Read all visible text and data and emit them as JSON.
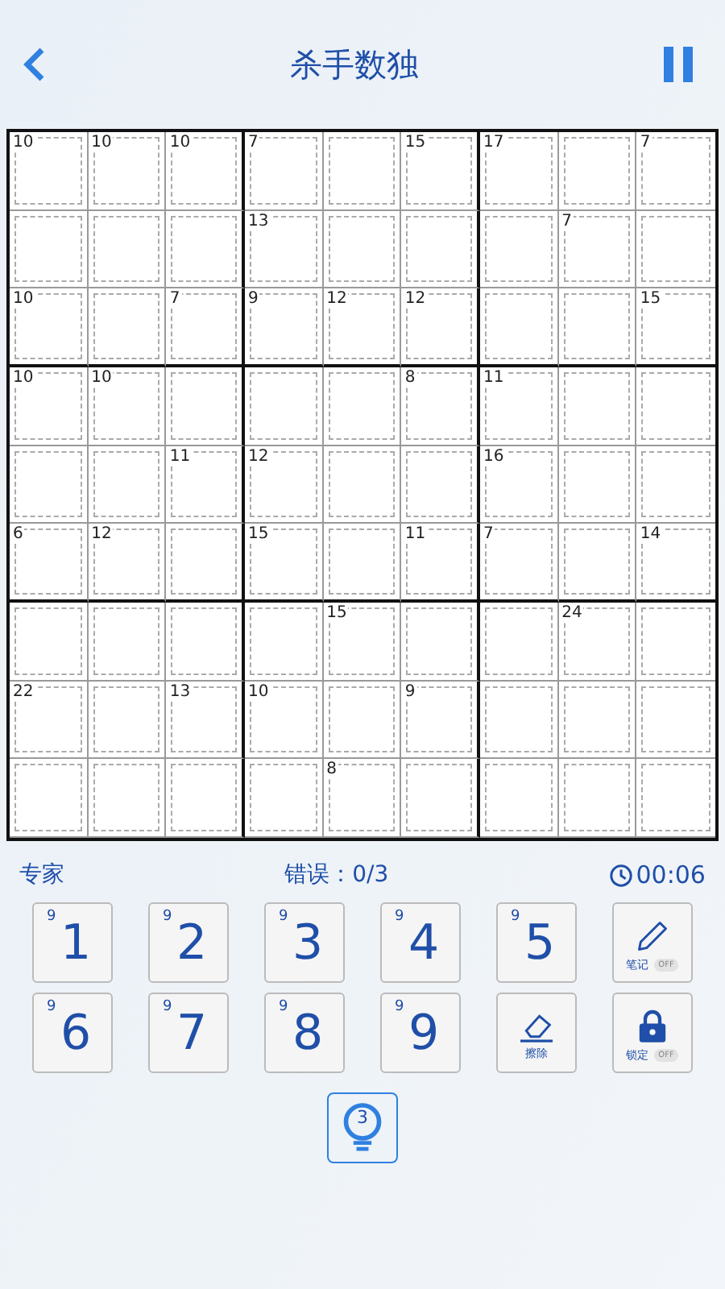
{
  "header": {
    "title": "杀手数独"
  },
  "grid": {
    "rows": [
      [
        {
          "sum": "10"
        },
        {
          "sum": "10"
        },
        {
          "sum": "10"
        },
        {
          "sum": "7"
        },
        {},
        {
          "sum": "15"
        },
        {
          "sum": "17"
        },
        {},
        {
          "sum": "7"
        }
      ],
      [
        {},
        {},
        {},
        {
          "sum": "13"
        },
        {},
        {},
        {},
        {
          "sum": "7"
        },
        {}
      ],
      [
        {
          "sum": "10"
        },
        {},
        {
          "sum": "7"
        },
        {
          "sum": "9"
        },
        {
          "sum": "12"
        },
        {
          "sum": "12"
        },
        {},
        {},
        {
          "sum": "15"
        }
      ],
      [
        {
          "sum": "10"
        },
        {
          "sum": "10"
        },
        {},
        {},
        {},
        {
          "sum": "8"
        },
        {
          "sum": "11"
        },
        {},
        {}
      ],
      [
        {},
        {},
        {
          "sum": "11"
        },
        {
          "sum": "12"
        },
        {},
        {},
        {
          "sum": "16"
        },
        {},
        {}
      ],
      [
        {
          "sum": "6"
        },
        {
          "sum": "12"
        },
        {},
        {
          "sum": "15"
        },
        {},
        {
          "sum": "11"
        },
        {
          "sum": "7"
        },
        {},
        {
          "sum": "14"
        }
      ],
      [
        {},
        {},
        {},
        {},
        {
          "sum": "15"
        },
        {},
        {},
        {
          "sum": "24"
        },
        {}
      ],
      [
        {
          "sum": "22"
        },
        {},
        {
          "sum": "13"
        },
        {
          "sum": "10"
        },
        {},
        {
          "sum": "9"
        },
        {},
        {},
        {}
      ],
      [
        {},
        {},
        {},
        {},
        {
          "sum": "8"
        },
        {},
        {},
        {},
        {}
      ]
    ]
  },
  "info": {
    "difficulty": "专家",
    "mistakes": "错误：0/3",
    "timer": "00:06"
  },
  "keypad": [
    {
      "kind": "digit",
      "label": "1",
      "remaining": "9"
    },
    {
      "kind": "digit",
      "label": "2",
      "remaining": "9"
    },
    {
      "kind": "digit",
      "label": "3",
      "remaining": "9"
    },
    {
      "kind": "digit",
      "label": "4",
      "remaining": "9"
    },
    {
      "kind": "digit",
      "label": "5",
      "remaining": "9"
    },
    {
      "kind": "notes",
      "label": "笔记",
      "toggle": "OFF",
      "on": false
    },
    {
      "kind": "digit",
      "label": "6",
      "remaining": "9"
    },
    {
      "kind": "digit",
      "label": "7",
      "remaining": "9"
    },
    {
      "kind": "digit",
      "label": "8",
      "remaining": "9"
    },
    {
      "kind": "digit",
      "label": "9",
      "remaining": "9"
    },
    {
      "kind": "erase",
      "label": "擦除"
    },
    {
      "kind": "lock",
      "label": "锁定",
      "toggle": "OFF",
      "on": false
    }
  ],
  "hint": {
    "count": "3"
  }
}
